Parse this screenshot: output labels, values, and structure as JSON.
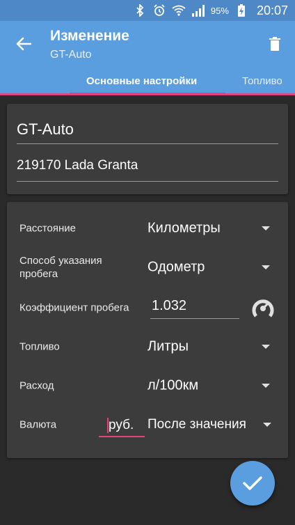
{
  "status_bar": {
    "battery": "95%",
    "time": "20:07"
  },
  "app_bar": {
    "title": "Изменение",
    "subtitle": "GT-Auto",
    "tabs": [
      {
        "label": "Основные настройки",
        "active": true
      },
      {
        "label": "Топливо",
        "active": false
      }
    ]
  },
  "vehicle": {
    "name": "GT-Auto",
    "model": "219170 Lada Granta"
  },
  "settings": {
    "distance": {
      "label": "Расстояние",
      "value": "Километры"
    },
    "mileage_method": {
      "label_line1": "Способ указания",
      "label_line2": "пробега",
      "value": "Одометр"
    },
    "mileage_coef": {
      "label": "Коэффициент пробега",
      "value": "1.032"
    },
    "fuel": {
      "label": "Топливо",
      "value": "Литры"
    },
    "consumption": {
      "label": "Расход",
      "value": "л/100км"
    },
    "currency": {
      "label": "Валюта",
      "symbol": "руб.",
      "position": "После значения"
    }
  },
  "colors": {
    "primary": "#5b9ee0",
    "primary_dark": "#4e88c6",
    "accent": "#e8407a",
    "background": "#2a2a2a",
    "card": "#3c3c3c"
  },
  "icons": [
    "bluetooth-icon",
    "alarm-icon",
    "wifi-icon",
    "signal-icon",
    "battery-charging-icon",
    "back-arrow-icon",
    "trash-icon",
    "gauge-icon",
    "checkmark-icon"
  ]
}
